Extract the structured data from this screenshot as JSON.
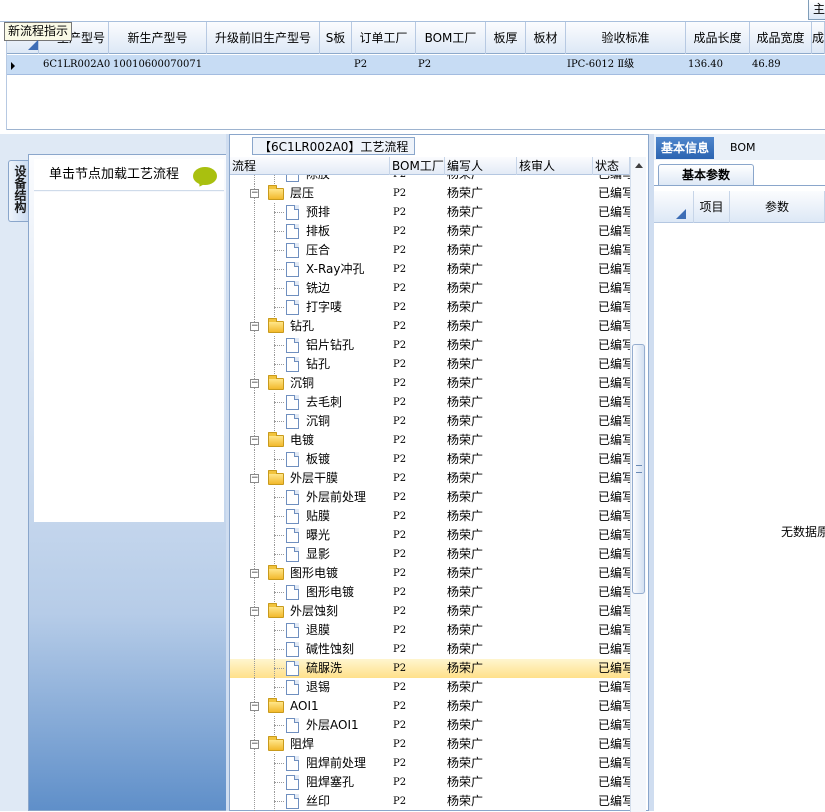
{
  "top_toolbar": {
    "main_tab_label": "主"
  },
  "tooltip": "新流程指示",
  "grid": {
    "columns": [
      "生产型号",
      "新生产型号",
      "升级前旧生产型号",
      "S板",
      "订单工厂",
      "BOM工厂",
      "板厚",
      "板材",
      "验收标准",
      "成品长度",
      "成品宽度",
      "成"
    ],
    "row": {
      "model": "6C1LR002A0",
      "new_model": "10010600070071",
      "old_model": "",
      "s_board": "",
      "order_factory": "P2",
      "bom_factory": "P2",
      "thickness": "",
      "material": "",
      "standard": "IPC-6012 Ⅱ级",
      "length": "136.40",
      "width": "46.89"
    }
  },
  "left_panel": {
    "side_tab_label": "设备结构",
    "hint": "单击节点加载工艺流程"
  },
  "center_panel": {
    "caption": "【6C1LR002A0】工艺流程",
    "columns": [
      "流程",
      "BOM工厂",
      "编写人",
      "核审人",
      "状态"
    ],
    "rows": [
      {
        "level": 1,
        "type": "doc",
        "name": "除胶",
        "bom": "P2",
        "author": "杨荣广",
        "reviewer": "",
        "status": "已编写"
      },
      {
        "level": 0,
        "type": "folder",
        "name": "层压",
        "bom": "P2",
        "author": "杨荣广",
        "reviewer": "",
        "status": "已编写"
      },
      {
        "level": 1,
        "type": "doc",
        "name": "预排",
        "bom": "P2",
        "author": "杨荣广",
        "reviewer": "",
        "status": "已编写"
      },
      {
        "level": 1,
        "type": "doc",
        "name": "排板",
        "bom": "P2",
        "author": "杨荣广",
        "reviewer": "",
        "status": "已编写"
      },
      {
        "level": 1,
        "type": "doc",
        "name": "压合",
        "bom": "P2",
        "author": "杨荣广",
        "reviewer": "",
        "status": "已编写"
      },
      {
        "level": 1,
        "type": "doc",
        "name": "X-Ray冲孔",
        "bom": "P2",
        "author": "杨荣广",
        "reviewer": "",
        "status": "已编写"
      },
      {
        "level": 1,
        "type": "doc",
        "name": "铣边",
        "bom": "P2",
        "author": "杨荣广",
        "reviewer": "",
        "status": "已编写"
      },
      {
        "level": 1,
        "type": "doc",
        "name": "打字唛",
        "bom": "P2",
        "author": "杨荣广",
        "reviewer": "",
        "status": "已编写"
      },
      {
        "level": 0,
        "type": "folder",
        "name": "钻孔",
        "bom": "P2",
        "author": "杨荣广",
        "reviewer": "",
        "status": "已编写"
      },
      {
        "level": 1,
        "type": "doc",
        "name": "铝片钻孔",
        "bom": "P2",
        "author": "杨荣广",
        "reviewer": "",
        "status": "已编写"
      },
      {
        "level": 1,
        "type": "doc",
        "name": "钻孔",
        "bom": "P2",
        "author": "杨荣广",
        "reviewer": "",
        "status": "已编写"
      },
      {
        "level": 0,
        "type": "folder",
        "name": "沉铜",
        "bom": "P2",
        "author": "杨荣广",
        "reviewer": "",
        "status": "已编写"
      },
      {
        "level": 1,
        "type": "doc",
        "name": "去毛刺",
        "bom": "P2",
        "author": "杨荣广",
        "reviewer": "",
        "status": "已编写"
      },
      {
        "level": 1,
        "type": "doc",
        "name": "沉铜",
        "bom": "P2",
        "author": "杨荣广",
        "reviewer": "",
        "status": "已编写"
      },
      {
        "level": 0,
        "type": "folder",
        "name": "电镀",
        "bom": "P2",
        "author": "杨荣广",
        "reviewer": "",
        "status": "已编写"
      },
      {
        "level": 1,
        "type": "doc",
        "name": "板镀",
        "bom": "P2",
        "author": "杨荣广",
        "reviewer": "",
        "status": "已编写"
      },
      {
        "level": 0,
        "type": "folder",
        "name": "外层干膜",
        "bom": "P2",
        "author": "杨荣广",
        "reviewer": "",
        "status": "已编写"
      },
      {
        "level": 1,
        "type": "doc",
        "name": "外层前处理",
        "bom": "P2",
        "author": "杨荣广",
        "reviewer": "",
        "status": "已编写"
      },
      {
        "level": 1,
        "type": "doc",
        "name": "贴膜",
        "bom": "P2",
        "author": "杨荣广",
        "reviewer": "",
        "status": "已编写"
      },
      {
        "level": 1,
        "type": "doc",
        "name": "曝光",
        "bom": "P2",
        "author": "杨荣广",
        "reviewer": "",
        "status": "已编写"
      },
      {
        "level": 1,
        "type": "doc",
        "name": "显影",
        "bom": "P2",
        "author": "杨荣广",
        "reviewer": "",
        "status": "已编写"
      },
      {
        "level": 0,
        "type": "folder",
        "name": "图形电镀",
        "bom": "P2",
        "author": "杨荣广",
        "reviewer": "",
        "status": "已编写"
      },
      {
        "level": 1,
        "type": "doc",
        "name": "图形电镀",
        "bom": "P2",
        "author": "杨荣广",
        "reviewer": "",
        "status": "已编写"
      },
      {
        "level": 0,
        "type": "folder",
        "name": "外层蚀刻",
        "bom": "P2",
        "author": "杨荣广",
        "reviewer": "",
        "status": "已编写"
      },
      {
        "level": 1,
        "type": "doc",
        "name": "退膜",
        "bom": "P2",
        "author": "杨荣广",
        "reviewer": "",
        "status": "已编写"
      },
      {
        "level": 1,
        "type": "doc",
        "name": "碱性蚀刻",
        "bom": "P2",
        "author": "杨荣广",
        "reviewer": "",
        "status": "已编写"
      },
      {
        "level": 1,
        "type": "doc",
        "name": "硫脲洗",
        "bom": "P2",
        "author": "杨荣广",
        "reviewer": "",
        "status": "已编写",
        "selected": true
      },
      {
        "level": 1,
        "type": "doc",
        "name": "退锡",
        "bom": "P2",
        "author": "杨荣广",
        "reviewer": "",
        "status": "已编写"
      },
      {
        "level": 0,
        "type": "folder",
        "name": "AOI1",
        "bom": "P2",
        "author": "杨荣广",
        "reviewer": "",
        "status": "已编写"
      },
      {
        "level": 1,
        "type": "doc",
        "name": "外层AOI1",
        "bom": "P2",
        "author": "杨荣广",
        "reviewer": "",
        "status": "已编写"
      },
      {
        "level": 0,
        "type": "folder",
        "name": "阻焊",
        "bom": "P2",
        "author": "杨荣广",
        "reviewer": "",
        "status": "已编写"
      },
      {
        "level": 1,
        "type": "doc",
        "name": "阻焊前处理",
        "bom": "P2",
        "author": "杨荣广",
        "reviewer": "",
        "status": "已编写"
      },
      {
        "level": 1,
        "type": "doc",
        "name": "阻焊塞孔",
        "bom": "P2",
        "author": "杨荣广",
        "reviewer": "",
        "status": "已编写"
      },
      {
        "level": 1,
        "type": "doc",
        "name": "丝印",
        "bom": "P2",
        "author": "杨荣广",
        "reviewer": "",
        "status": "已编写"
      }
    ]
  },
  "right_panel": {
    "tabs": [
      "基本信息",
      "BOM"
    ],
    "subtab": "基本参数",
    "columns": [
      "项目",
      "参数"
    ],
    "empty_text": "无数据原"
  },
  "colors": {
    "selected_row": "#ffe08a",
    "grid_row": "#c7dcf4",
    "active_tab": "#2b64b1"
  }
}
